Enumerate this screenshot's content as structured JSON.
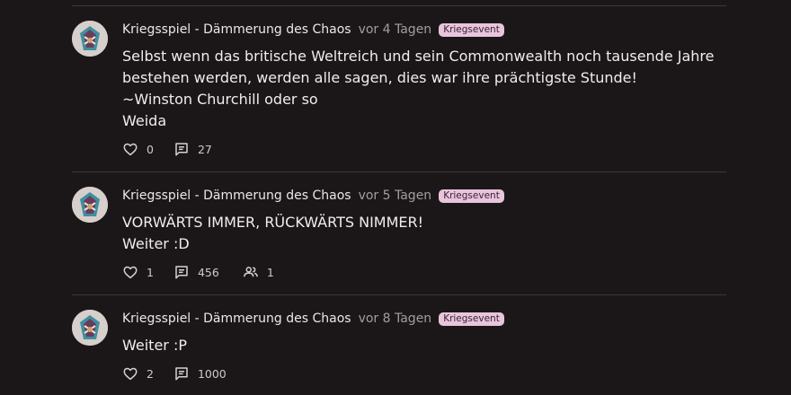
{
  "posts": [
    {
      "author": "Kriegsspiel - Dämmerung des Chaos",
      "time": "vor 4 Tagen",
      "badge": "Kriegsevent",
      "lines": [
        "Selbst wenn das britische Weltreich und sein Commonwealth noch tausende Jahre",
        "bestehen werden, werden alle sagen, dies war ihre prächtigste Stunde!",
        "~Winston Churchill oder so",
        "Weida"
      ],
      "likes": "0",
      "comments": "27"
    },
    {
      "author": "Kriegsspiel - Dämmerung des Chaos",
      "time": "vor 5 Tagen",
      "badge": "Kriegsevent",
      "lines": [
        "VORWÄRTS IMMER, RÜCKWÄRTS NIMMER!",
        "Weiter :D"
      ],
      "likes": "1",
      "comments": "456",
      "members": "1"
    },
    {
      "author": "Kriegsspiel - Dämmerung des Chaos",
      "time": "vor 8 Tagen",
      "badge": "Kriegsevent",
      "lines": [
        "Weiter :P"
      ],
      "likes": "2",
      "comments": "1000"
    }
  ]
}
